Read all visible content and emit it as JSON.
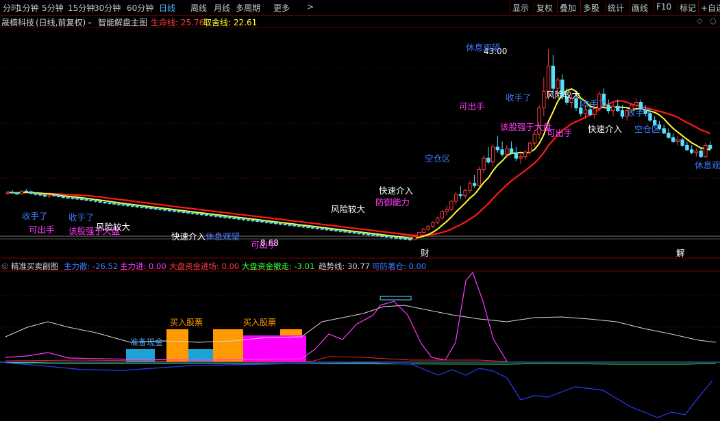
{
  "toolbar": {
    "periods": [
      "分时",
      "1分钟",
      "5分钟",
      "15分钟",
      "30分钟",
      "60分钟",
      "日线",
      "周线",
      "月线",
      "多周期",
      "更多"
    ],
    "active_period": "日线",
    "more_arrow": ">",
    "right_buttons": [
      "显示",
      "复权",
      "叠加",
      "多股",
      "统计",
      "画线",
      "F10",
      "标记",
      "+自选"
    ]
  },
  "main_header": {
    "stock": "晟楠科技",
    "mode": "(日线,前复权)",
    "mode_arrow": "⌄",
    "indicator": "智能解盘主图",
    "life_line_label": "生命线: 25.76",
    "take_profit_label": "取舍线: 22.61"
  },
  "sub_header": {
    "indicator": "精准买卖副图",
    "main_force": "主力散: -26.52",
    "main_in": "主力进: 0.00",
    "market_in": "大盘资金进场: 0.00",
    "market_out": "大盘资金撤走: -3.01",
    "trend": "趋势线: 30.77",
    "reduce": "可防著仓: 0.00"
  },
  "colors": {
    "bg": "#000000",
    "up": "#ff3b3b",
    "down": "#55e0ff",
    "yellow": "#ffff2a",
    "red_line": "#ff1a1a",
    "grid": "#5a0000",
    "orange": "#ff9a00",
    "magenta": "#ff00ff",
    "cyan_bar": "#1ba5d6"
  },
  "price_labels": {
    "high": "43.00",
    "low": "8.68"
  },
  "chart_annotations": [
    {
      "text": "收手了",
      "color": "#3f7cff"
    },
    {
      "text": "可出手",
      "color": "#ff3bff"
    },
    {
      "text": "收手了",
      "color": "#3f7cff"
    },
    {
      "text": "该股强于大盘",
      "color": "#ff3bff"
    },
    {
      "text": "风险较大",
      "color": "#ffffff"
    },
    {
      "text": "快速介入",
      "color": "#ffffff"
    },
    {
      "text": "休息观望",
      "color": "#3f7cff"
    },
    {
      "text": "可出手",
      "color": "#ff3bff"
    },
    {
      "text": "风险较大",
      "color": "#ffffff"
    },
    {
      "text": "快速介入",
      "color": "#ffffff"
    },
    {
      "text": "防御能力",
      "color": "#ff3bff"
    },
    {
      "text": "空仓区",
      "color": "#3f7cff"
    },
    {
      "text": "休息观望",
      "color": "#3f7cff"
    },
    {
      "text": "可出手",
      "color": "#ff3bff"
    },
    {
      "text": "收手了",
      "color": "#3f7cff"
    },
    {
      "text": "风险较大",
      "color": "#ffffff"
    },
    {
      "text": "该股强于大盘",
      "color": "#ff3bff"
    },
    {
      "text": "可出手",
      "color": "#ff3bff"
    },
    {
      "text": "收手了",
      "color": "#3f7cff"
    },
    {
      "text": "快速介入",
      "color": "#ffffff"
    },
    {
      "text": "收手了",
      "color": "#3f7cff"
    },
    {
      "text": "空仓区",
      "color": "#3f7cff"
    },
    {
      "text": "休息观望",
      "color": "#3f7cff"
    },
    {
      "text": "财",
      "color": "#ffffff"
    },
    {
      "text": "解",
      "color": "#ffffff"
    }
  ],
  "sub_labels": {
    "prepare_cash": "准备现金",
    "buy1": "买入股票",
    "buy2": "买入股票"
  },
  "chart_data": {
    "type": "candlestick",
    "candles": [
      [
        17.2,
        17.6,
        17.0,
        17.4
      ],
      [
        17.4,
        17.8,
        17.1,
        17.3
      ],
      [
        17.3,
        17.5,
        16.9,
        17.1
      ],
      [
        17.1,
        17.7,
        17.0,
        17.6
      ],
      [
        17.6,
        18.0,
        17.3,
        17.5
      ],
      [
        17.5,
        17.7,
        17.0,
        17.2
      ],
      [
        17.2,
        17.4,
        16.8,
        17.0
      ],
      [
        17.0,
        17.3,
        16.7,
        16.9
      ],
      [
        16.9,
        17.1,
        16.5,
        16.7
      ],
      [
        16.7,
        17.0,
        16.4,
        16.9
      ],
      [
        16.9,
        17.2,
        16.6,
        16.8
      ],
      [
        16.8,
        17.1,
        16.5,
        16.6
      ],
      [
        16.6,
        16.9,
        16.3,
        16.5
      ],
      [
        16.5,
        16.8,
        16.2,
        16.4
      ],
      [
        16.4,
        16.7,
        16.1,
        16.3
      ],
      [
        16.3,
        16.6,
        16.0,
        16.2
      ],
      [
        16.2,
        16.5,
        15.9,
        16.1
      ],
      [
        16.1,
        16.4,
        15.8,
        16.0
      ],
      [
        16.0,
        16.3,
        15.7,
        15.9
      ],
      [
        15.9,
        16.2,
        15.6,
        15.8
      ],
      [
        15.8,
        16.1,
        15.5,
        15.6
      ],
      [
        15.6,
        15.9,
        15.3,
        15.5
      ],
      [
        15.5,
        15.8,
        15.2,
        15.4
      ],
      [
        15.4,
        15.7,
        15.1,
        15.3
      ],
      [
        15.3,
        15.6,
        15.0,
        15.2
      ],
      [
        15.2,
        15.5,
        14.9,
        15.1
      ],
      [
        15.1,
        15.4,
        14.8,
        15.0
      ],
      [
        15.0,
        15.3,
        14.7,
        14.9
      ],
      [
        14.9,
        15.2,
        14.6,
        14.8
      ],
      [
        14.8,
        15.1,
        14.5,
        14.7
      ],
      [
        14.7,
        15.0,
        14.4,
        14.6
      ],
      [
        14.6,
        14.9,
        14.3,
        14.5
      ],
      [
        14.5,
        14.8,
        14.2,
        14.4
      ],
      [
        14.4,
        14.7,
        14.1,
        14.3
      ],
      [
        14.3,
        14.6,
        14.0,
        14.2
      ],
      [
        14.2,
        14.5,
        13.9,
        14.1
      ],
      [
        14.1,
        14.4,
        13.8,
        14.0
      ],
      [
        14.0,
        14.3,
        13.7,
        13.9
      ],
      [
        13.9,
        14.2,
        13.6,
        13.8
      ],
      [
        13.8,
        14.1,
        13.5,
        13.7
      ],
      [
        13.7,
        14.0,
        13.4,
        13.6
      ],
      [
        13.6,
        13.9,
        13.3,
        13.5
      ],
      [
        13.5,
        13.8,
        13.2,
        13.4
      ],
      [
        13.4,
        13.7,
        13.1,
        13.3
      ],
      [
        13.3,
        13.6,
        13.0,
        13.2
      ],
      [
        13.2,
        13.5,
        12.9,
        13.1
      ],
      [
        13.1,
        13.4,
        12.8,
        13.0
      ],
      [
        13.0,
        13.3,
        12.7,
        12.9
      ],
      [
        12.9,
        13.2,
        12.6,
        12.8
      ],
      [
        12.8,
        13.1,
        12.5,
        12.7
      ],
      [
        12.7,
        13.0,
        12.4,
        12.6
      ],
      [
        12.6,
        12.9,
        12.3,
        12.5
      ],
      [
        12.5,
        12.8,
        12.2,
        12.4
      ],
      [
        12.4,
        12.7,
        12.1,
        12.3
      ],
      [
        12.3,
        12.6,
        12.0,
        12.2
      ],
      [
        12.2,
        12.5,
        11.9,
        12.1
      ],
      [
        12.1,
        12.4,
        11.8,
        12.0
      ],
      [
        12.0,
        12.3,
        11.7,
        11.9
      ],
      [
        11.9,
        12.2,
        11.6,
        11.8
      ],
      [
        11.8,
        12.1,
        11.5,
        11.7
      ],
      [
        11.7,
        12.0,
        11.4,
        11.6
      ],
      [
        11.6,
        11.9,
        11.3,
        11.5
      ],
      [
        11.5,
        11.8,
        11.2,
        11.4
      ],
      [
        11.4,
        11.7,
        11.1,
        11.3
      ],
      [
        11.3,
        11.6,
        11.0,
        11.2
      ],
      [
        11.2,
        11.5,
        10.9,
        11.1
      ],
      [
        11.1,
        11.4,
        10.8,
        11.0
      ],
      [
        11.0,
        11.3,
        10.7,
        10.9
      ],
      [
        10.9,
        11.2,
        10.6,
        10.8
      ],
      [
        10.8,
        11.1,
        10.5,
        10.7
      ],
      [
        10.7,
        11.0,
        10.4,
        10.6
      ],
      [
        10.6,
        10.9,
        10.3,
        10.5
      ],
      [
        10.5,
        10.8,
        10.2,
        10.4
      ],
      [
        10.4,
        10.7,
        10.1,
        10.3
      ],
      [
        10.3,
        10.6,
        10.0,
        10.2
      ],
      [
        10.2,
        10.5,
        9.9,
        10.1
      ],
      [
        10.1,
        10.4,
        9.8,
        10.0
      ],
      [
        10.0,
        10.3,
        9.7,
        9.9
      ],
      [
        9.9,
        10.2,
        9.6,
        9.8
      ],
      [
        9.8,
        10.1,
        9.5,
        9.7
      ],
      [
        9.7,
        10.0,
        9.4,
        9.6
      ],
      [
        9.6,
        9.9,
        9.3,
        9.5
      ],
      [
        9.5,
        9.8,
        9.2,
        9.4
      ],
      [
        9.4,
        9.7,
        9.1,
        9.3
      ],
      [
        9.3,
        9.6,
        9.0,
        9.2
      ],
      [
        9.2,
        9.5,
        8.9,
        9.1
      ],
      [
        9.1,
        9.4,
        8.8,
        9.0
      ],
      [
        9.0,
        9.3,
        8.68,
        8.9
      ],
      [
        8.9,
        9.6,
        8.8,
        9.5
      ],
      [
        9.5,
        10.3,
        9.3,
        10.2
      ],
      [
        10.2,
        11.0,
        10.0,
        10.8
      ],
      [
        10.8,
        11.5,
        10.5,
        11.3
      ],
      [
        11.3,
        12.2,
        11.0,
        12.0
      ],
      [
        12.0,
        13.0,
        11.7,
        12.8
      ],
      [
        12.8,
        14.2,
        12.5,
        13.9
      ],
      [
        13.9,
        15.0,
        13.2,
        14.3
      ],
      [
        14.3,
        16.0,
        13.9,
        15.8
      ],
      [
        15.8,
        17.5,
        15.2,
        17.0
      ],
      [
        17.0,
        18.5,
        16.2,
        16.8
      ],
      [
        16.8,
        18.0,
        16.3,
        17.7
      ],
      [
        17.7,
        19.5,
        17.2,
        19.0
      ],
      [
        19.0,
        20.5,
        18.2,
        18.6
      ],
      [
        18.6,
        22.0,
        18.3,
        21.5
      ],
      [
        21.5,
        24.0,
        20.8,
        23.5
      ],
      [
        23.5,
        25.5,
        22.5,
        22.8
      ],
      [
        22.8,
        26.0,
        22.0,
        25.5
      ],
      [
        25.5,
        27.5,
        24.5,
        25.0
      ],
      [
        25.0,
        26.5,
        23.8,
        24.2
      ],
      [
        24.2,
        25.8,
        23.5,
        25.2
      ],
      [
        25.2,
        26.5,
        24.2,
        24.5
      ],
      [
        24.5,
        25.5,
        23.0,
        23.5
      ],
      [
        23.5,
        24.5,
        22.5,
        23.8
      ],
      [
        23.8,
        25.0,
        23.2,
        24.6
      ],
      [
        24.6,
        26.5,
        24.0,
        26.2
      ],
      [
        26.2,
        28.5,
        25.5,
        27.8
      ],
      [
        27.8,
        33.0,
        27.0,
        32.5
      ],
      [
        32.5,
        38.0,
        31.0,
        35.5
      ],
      [
        35.5,
        43.0,
        34.0,
        40.0
      ],
      [
        40.0,
        42.0,
        35.0,
        36.0
      ],
      [
        36.0,
        38.0,
        34.5,
        37.5
      ],
      [
        37.5,
        38.5,
        34.0,
        34.5
      ],
      [
        34.5,
        36.0,
        33.0,
        33.5
      ],
      [
        33.5,
        35.0,
        32.5,
        34.2
      ],
      [
        34.2,
        35.5,
        32.0,
        32.5
      ],
      [
        32.5,
        34.0,
        31.0,
        31.5
      ],
      [
        31.5,
        33.0,
        30.5,
        32.2
      ],
      [
        32.2,
        33.5,
        31.0,
        31.3
      ],
      [
        31.3,
        33.0,
        30.5,
        32.4
      ],
      [
        32.4,
        35.5,
        32.0,
        35.0
      ],
      [
        35.0,
        36.0,
        32.5,
        33.0
      ],
      [
        33.0,
        34.0,
        31.5,
        32.0
      ],
      [
        32.0,
        33.5,
        31.0,
        32.8
      ],
      [
        32.8,
        34.0,
        31.8,
        32.0
      ],
      [
        32.0,
        33.0,
        30.5,
        31.0
      ],
      [
        31.0,
        32.5,
        30.2,
        32.0
      ],
      [
        32.0,
        33.5,
        31.5,
        33.0
      ],
      [
        33.0,
        34.2,
        32.5,
        33.5
      ],
      [
        33.5,
        34.0,
        32.0,
        32.2
      ],
      [
        32.2,
        33.0,
        31.0,
        31.5
      ],
      [
        31.5,
        32.0,
        30.0,
        30.3
      ],
      [
        30.3,
        31.0,
        29.2,
        29.5
      ],
      [
        29.5,
        30.2,
        28.5,
        28.8
      ],
      [
        28.8,
        29.5,
        27.8,
        28.0
      ],
      [
        28.0,
        28.8,
        27.0,
        27.2
      ],
      [
        27.2,
        28.0,
        26.2,
        26.5
      ],
      [
        26.5,
        27.5,
        25.8,
        26.8
      ],
      [
        26.8,
        27.2,
        25.5,
        25.8
      ],
      [
        25.8,
        26.5,
        24.8,
        25.0
      ],
      [
        25.0,
        25.8,
        24.2,
        24.5
      ],
      [
        24.5,
        25.2,
        23.8,
        24.8
      ],
      [
        24.8,
        25.5,
        23.5,
        23.8
      ],
      [
        23.8,
        26.2,
        23.5,
        25.8
      ],
      [
        25.8,
        26.5,
        24.8,
        25.2
      ]
    ],
    "ylim": [
      8.68,
      43.0
    ]
  }
}
